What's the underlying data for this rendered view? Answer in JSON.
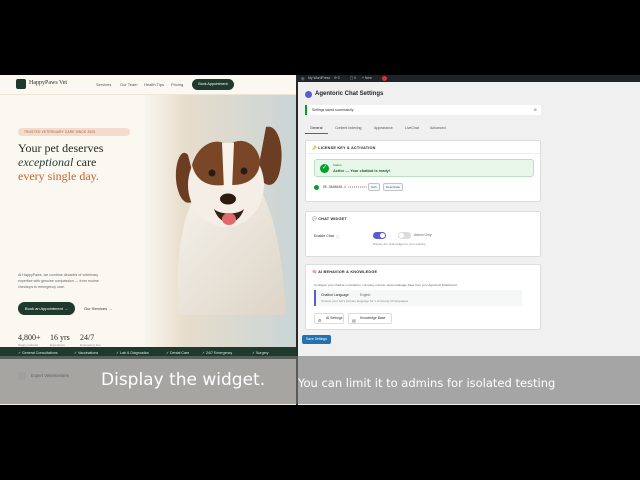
{
  "website": {
    "brand": "HappyPaws Vet",
    "nav": [
      "Services",
      "Our Team",
      "Health Tips",
      "Pricing"
    ],
    "nav_cta": "Book Appointment",
    "badge": "TRUSTED VETERINARY CARE SINCE 2005",
    "headline_1": "Your pet deserves",
    "headline_2_em": "exceptional",
    "headline_2_rest": " care",
    "headline_3": "every single day.",
    "paragraph": [
      "At HappyPaws, we combine decades of veterinary",
      "expertise with genuine compassion — from routine",
      "checkups to emergency care."
    ],
    "primary_button": "Book an Appointment →",
    "secondary_button": "Our Services →",
    "stats": [
      {
        "value": "4,800+",
        "label": "Happy patients"
      },
      {
        "value": "16 yrs",
        "label": "Experience"
      },
      {
        "value": "24/7",
        "label": "Emergency line"
      }
    ],
    "services": [
      "General Consultations",
      "Vaccinations",
      "Lab & Diagnostics",
      "Dental Care",
      "24/7 Emergency",
      "Surgery"
    ],
    "cards": [
      "Expert Veterinarians"
    ]
  },
  "wp": {
    "admin_bar": {
      "site": "My WordPress",
      "counts": "0",
      "new": "+ New"
    },
    "page_title": "Agentoric Chat Settings",
    "notice": "Settings saved successfully.",
    "tabs": [
      "General",
      "Content Indexing",
      "Appearance",
      "LiveChat",
      "Advanced"
    ],
    "license": {
      "heading": "LICENSE KEY & ACTIVATION",
      "status_label": "Status",
      "status_message": "Active — Your chatbot is ready!",
      "key": "DE-3848848-1 ••••••••••",
      "buttons": [
        "Edit",
        "Deactivate"
      ]
    },
    "widget": {
      "heading": "CHAT WIDGET",
      "enable_label": "Enable Chat",
      "info_mark": "ⓘ",
      "admin_only": "Admin Only",
      "help": "Display the chat widget on your website"
    },
    "ai": {
      "heading": "AI BEHAVIOR & KNOWLEDGE",
      "description": "Configure your chatbot on behavior, company context, and knowledge base from your Agentoric Dashboard.",
      "lang_label": "Chatbot Language",
      "lang_value": "English",
      "lang_help": "Choose your bot's primary language for 1 of among 10 languages.",
      "buttons": [
        "AI Settings",
        "Knowledge Base"
      ]
    },
    "save_button": "Save Settings"
  },
  "caption": {
    "main": "Display the widget.",
    "sub": "You can limit it to admins for isolated testing"
  }
}
